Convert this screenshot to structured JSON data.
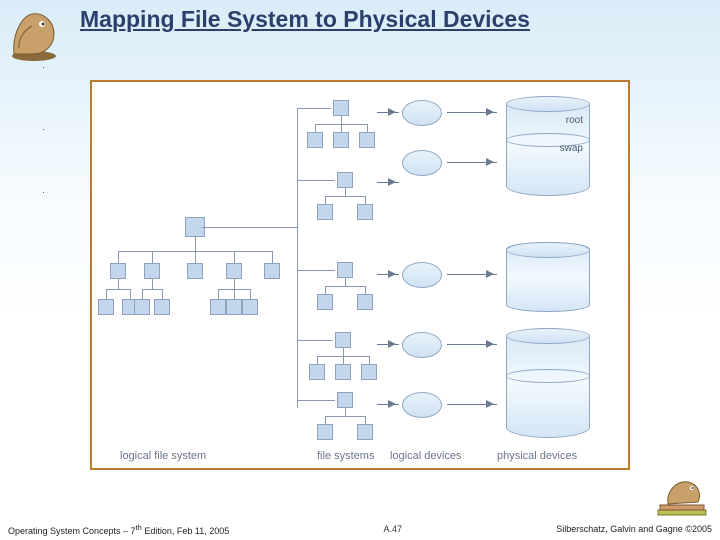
{
  "title": "Mapping File System to Physical Devices",
  "bullets": {
    "b1": "",
    "b2": "",
    "b3": ""
  },
  "diagram": {
    "captions": {
      "logical_fs": "logical file system",
      "file_systems": "file systems",
      "logical_devices": "logical devices",
      "physical_devices": "physical devices"
    },
    "cyl_labels": {
      "root": "root",
      "swap": "swap"
    }
  },
  "footer": {
    "left_a": "Operating System Concepts – 7",
    "left_sup": "th",
    "left_b": " Edition, Feb 11, 2005",
    "center": "A.47",
    "right_a": "Silberschatz, Galvin and Gagne ",
    "right_b": "2005"
  }
}
